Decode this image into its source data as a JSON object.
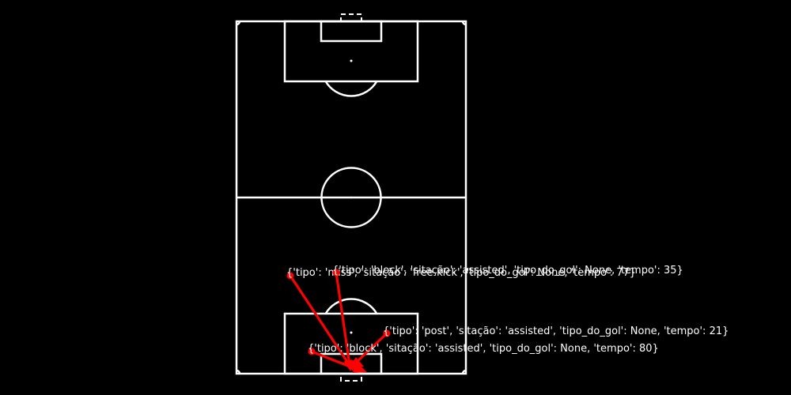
{
  "pitch": {
    "background_color": "#000000",
    "line_color": "#ffffff",
    "orientation": "vertical"
  },
  "shot_color": "#ff0000",
  "shots": [
    {
      "label": "{'tipo': 'miss', 'sitação': 'free-kick', 'tipo_do_gol': None, 'tempo': 77}"
    },
    {
      "label": "{'tipo': 'block', 'sitação': 'assisted', 'tipo_do_gol': None, 'tempo': 35}"
    },
    {
      "label": "{'tipo': 'post', 'sitação': 'assisted', 'tipo_do_gol': None, 'tempo': 21}"
    },
    {
      "label": "{'tipo': 'block', 'sitação': 'assisted', 'tipo_do_gol': None, 'tempo': 80}"
    }
  ]
}
